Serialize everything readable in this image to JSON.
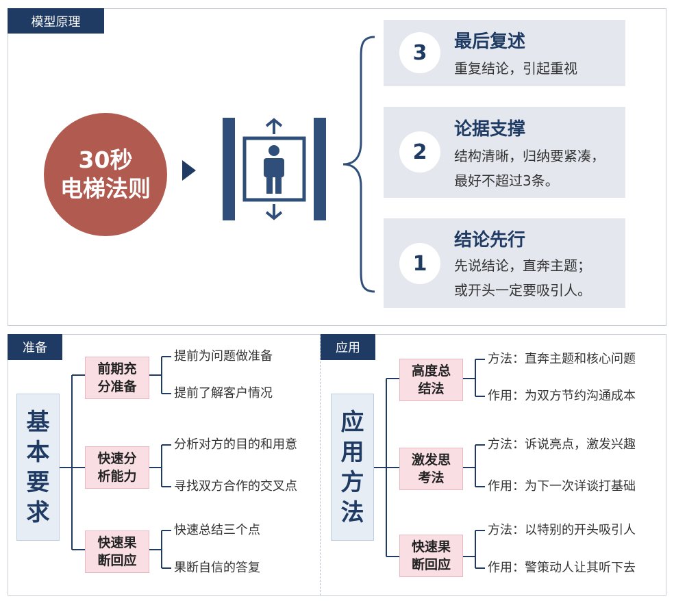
{
  "model": {
    "tag": "模型原理",
    "circle": {
      "line1": "30秒",
      "line2": "电梯法则"
    },
    "steps": [
      {
        "num": "3",
        "title": "最后复述",
        "lines": [
          "重复结论，引起重视"
        ]
      },
      {
        "num": "2",
        "title": "论据支撑",
        "lines": [
          "结构清晰，归纳要紧凑，",
          "最好不超过3条。"
        ]
      },
      {
        "num": "1",
        "title": "结论先行",
        "lines": [
          "先说结论，直奔主题；",
          "或开头一定要吸引人。"
        ]
      }
    ]
  },
  "prep": {
    "tag": "准备",
    "root": [
      "基",
      "本",
      "要",
      "求"
    ],
    "groups": [
      {
        "name": [
          "前期充",
          "分准备"
        ],
        "leaves": [
          "提前为问题做准备",
          "提前了解客户情况"
        ]
      },
      {
        "name": [
          "快速分",
          "析能力"
        ],
        "leaves": [
          "分析对方的目的和用意",
          "寻找双方合作的交叉点"
        ]
      },
      {
        "name": [
          "快速果",
          "断回应"
        ],
        "leaves": [
          "快速总结三个点",
          "果断自信的答复"
        ]
      }
    ]
  },
  "apply": {
    "tag": "应用",
    "root": [
      "应",
      "用",
      "方",
      "法"
    ],
    "groups": [
      {
        "name": [
          "高度总",
          "结法"
        ],
        "leaves": [
          "方法：直奔主题和核心问题",
          "作用：为双方节约沟通成本"
        ]
      },
      {
        "name": [
          "激发思",
          "考法"
        ],
        "leaves": [
          "方法：诉说亮点，激发兴趣",
          "作用：为下一次详谈打基础"
        ]
      },
      {
        "name": [
          "快速果",
          "断回应"
        ],
        "leaves": [
          "方法：以特别的开头吸引人",
          "作用：警策动人让其听下去"
        ]
      }
    ]
  },
  "colors": {
    "navy": "#1f3b64",
    "red_circle": "#b05a50",
    "step_bg": "#e4e8ee",
    "pink": "#f9dfe3"
  },
  "icons": [
    "play-arrow-icon",
    "elevator-person-icon",
    "brace-icon"
  ]
}
